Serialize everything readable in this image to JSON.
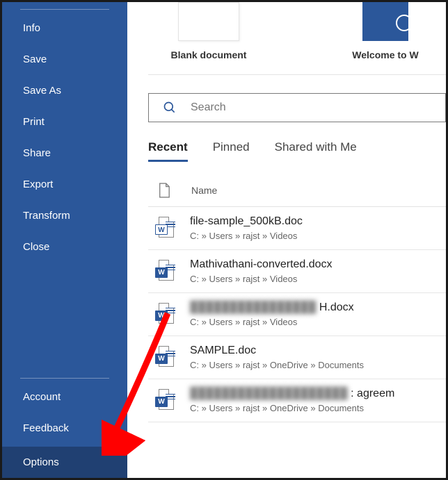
{
  "sidebar": {
    "items": [
      {
        "label": "Info"
      },
      {
        "label": "Save"
      },
      {
        "label": "Save As"
      },
      {
        "label": "Print"
      },
      {
        "label": "Share"
      },
      {
        "label": "Export"
      },
      {
        "label": "Transform"
      },
      {
        "label": "Close"
      }
    ],
    "lower_items": [
      {
        "label": "Account"
      },
      {
        "label": "Feedback"
      },
      {
        "label": "Options"
      }
    ]
  },
  "templates": [
    {
      "label": "Blank document"
    },
    {
      "label": "Welcome to W"
    }
  ],
  "search": {
    "placeholder": "Search"
  },
  "tabs": [
    {
      "label": "Recent",
      "active": true
    },
    {
      "label": "Pinned",
      "active": false
    },
    {
      "label": "Shared with Me",
      "active": false
    }
  ],
  "list_header": {
    "name_col": "Name"
  },
  "files": [
    {
      "name": "file-sample_500kB.doc",
      "path": "C: » Users » rajst » Videos",
      "icon": "legacy"
    },
    {
      "name": "Mathivathani-converted.docx",
      "path": "C: » Users » rajst » Videos",
      "icon": "modern"
    },
    {
      "name": "H.docx",
      "blurprefix": "████████████████",
      "path": "C: » Users » rajst » Videos",
      "icon": "modern"
    },
    {
      "name": "SAMPLE.doc",
      "path": "C: » Users » rajst » OneDrive » Documents",
      "icon": "modern"
    },
    {
      "name": ": agreem",
      "blurprefix": "████████████████████",
      "path": "C: » Users » rajst » OneDrive » Documents",
      "icon": "modern"
    }
  ]
}
